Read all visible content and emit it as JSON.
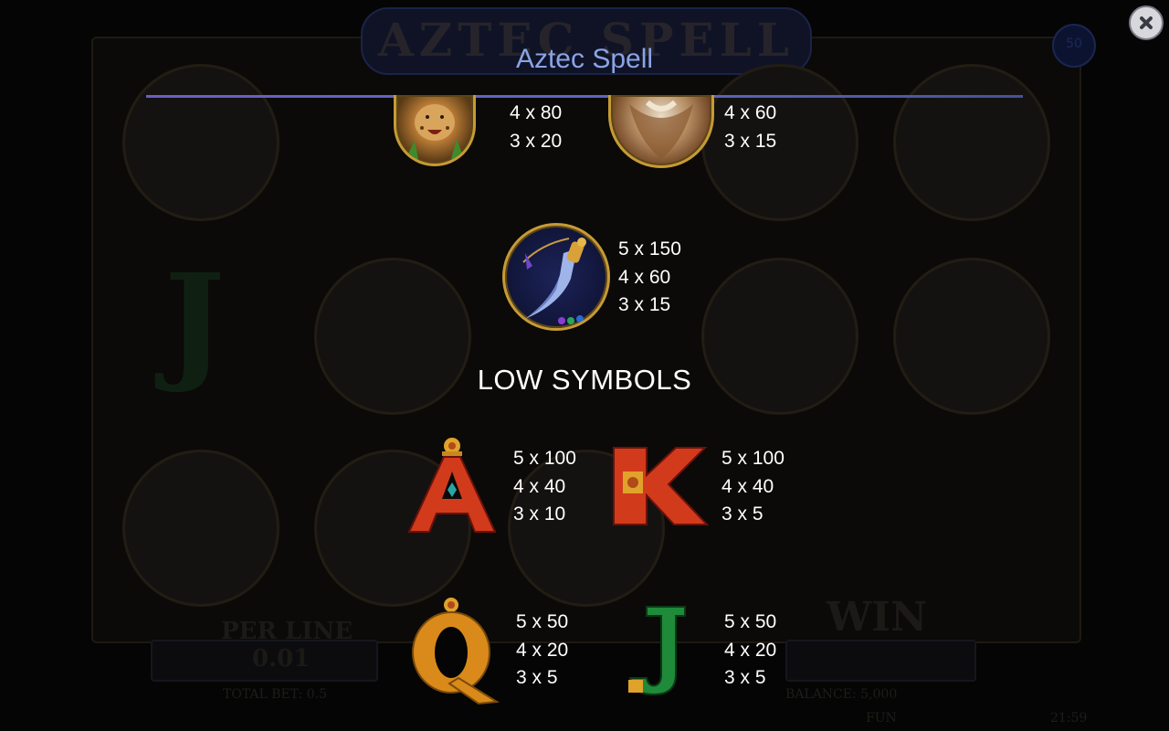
{
  "background": {
    "logo_text": "AZTEC SPELL",
    "bet_label": "PER LINE",
    "bet_value": "0.01",
    "total_bet": "TOTAL BET: 0.5",
    "balance": "BALANCE: 5,000",
    "fun_label": "FUN",
    "win_label": "WIN",
    "time": "21:59",
    "lines_badge": "50"
  },
  "header": {
    "title": "Aztec Spell",
    "close_icon": "close-icon"
  },
  "high_symbols": [
    {
      "symbol": "jaguar",
      "payouts": [
        "4 x 80",
        "3 x 20"
      ]
    },
    {
      "symbol": "eagle",
      "payouts": [
        "4 x 60",
        "3 x 15"
      ]
    },
    {
      "symbol": "dagger",
      "payouts": [
        "5 x 150",
        "4 x 60",
        "3 x 15"
      ]
    }
  ],
  "low_section": {
    "heading": "LOW SYMBOLS",
    "symbols": [
      {
        "symbol": "A",
        "payouts": [
          "5 x 100",
          "4 x 40",
          "3 x 10"
        ]
      },
      {
        "symbol": "K",
        "payouts": [
          "5 x 100",
          "4 x 40",
          "3 x 5"
        ]
      },
      {
        "symbol": "Q",
        "payouts": [
          "5 x 50",
          "4 x 20",
          "3 x 5"
        ]
      },
      {
        "symbol": "J",
        "payouts": [
          "5 x 50",
          "4 x 20",
          "3 x 5"
        ]
      }
    ]
  },
  "colors": {
    "title": "#8aa4e6",
    "rule": "#6b5fc4",
    "letter_red": "#d23a1c",
    "letter_gold": "#e0a22a",
    "letter_green": "#1f8a3a"
  }
}
